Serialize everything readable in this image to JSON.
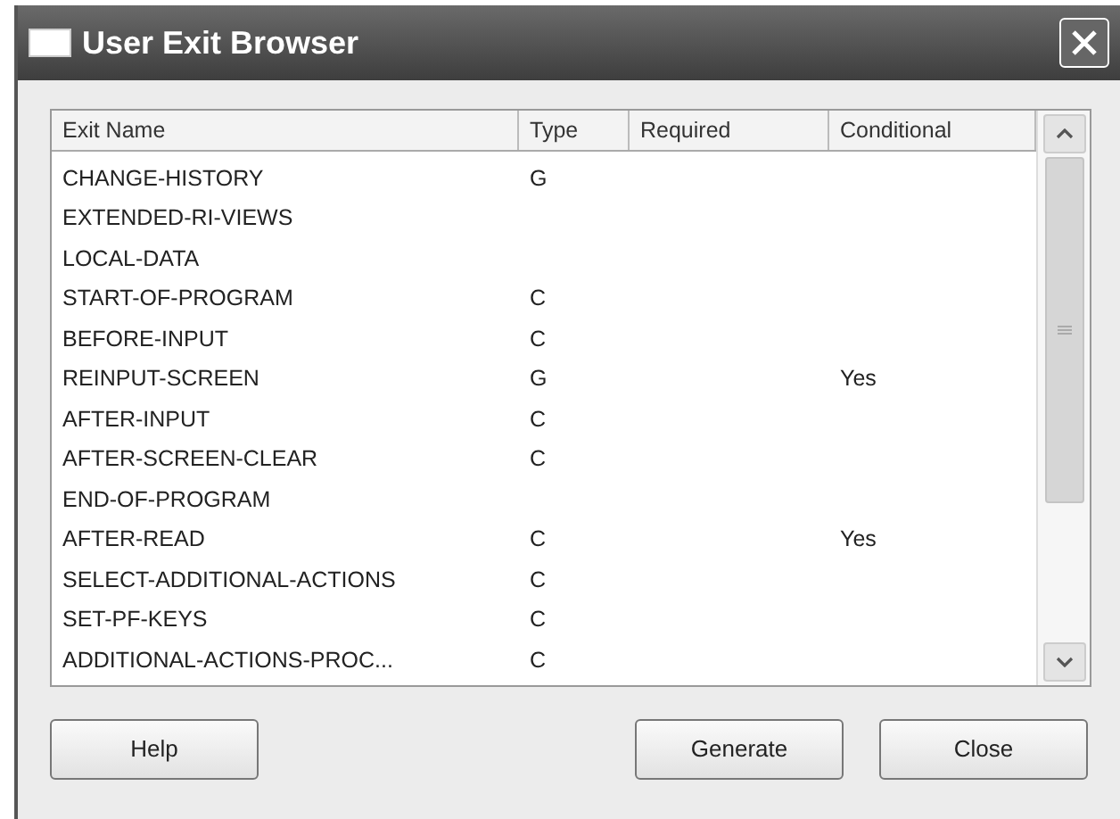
{
  "window": {
    "title": "User Exit Browser"
  },
  "table": {
    "columns": [
      "Exit Name",
      "Type",
      "Required",
      "Conditional"
    ],
    "rows": [
      {
        "exit_name": "CHANGE-HISTORY",
        "type": "G"
      },
      {
        "exit_name": "EXTENDED-RI-VIEWS"
      },
      {
        "exit_name": "LOCAL-DATA"
      },
      {
        "exit_name": "START-OF-PROGRAM",
        "type": "C"
      },
      {
        "exit_name": "BEFORE-INPUT",
        "type": "C"
      },
      {
        "exit_name": "REINPUT-SCREEN",
        "type": "G",
        "conditional": "Yes"
      },
      {
        "exit_name": "AFTER-INPUT",
        "type": "C"
      },
      {
        "exit_name": "AFTER-SCREEN-CLEAR",
        "type": "C"
      },
      {
        "exit_name": "END-OF-PROGRAM"
      },
      {
        "exit_name": "AFTER-READ",
        "type": "C",
        "conditional": "Yes"
      },
      {
        "exit_name": "SELECT-ADDITIONAL-ACTIONS",
        "type": "C"
      },
      {
        "exit_name": "SET-PF-KEYS",
        "type": "C"
      },
      {
        "exit_name": "ADDITIONAL-ACTIONS-PROC...",
        "type": "C"
      }
    ]
  },
  "buttons": [
    "Help",
    "Generate",
    "Close"
  ]
}
